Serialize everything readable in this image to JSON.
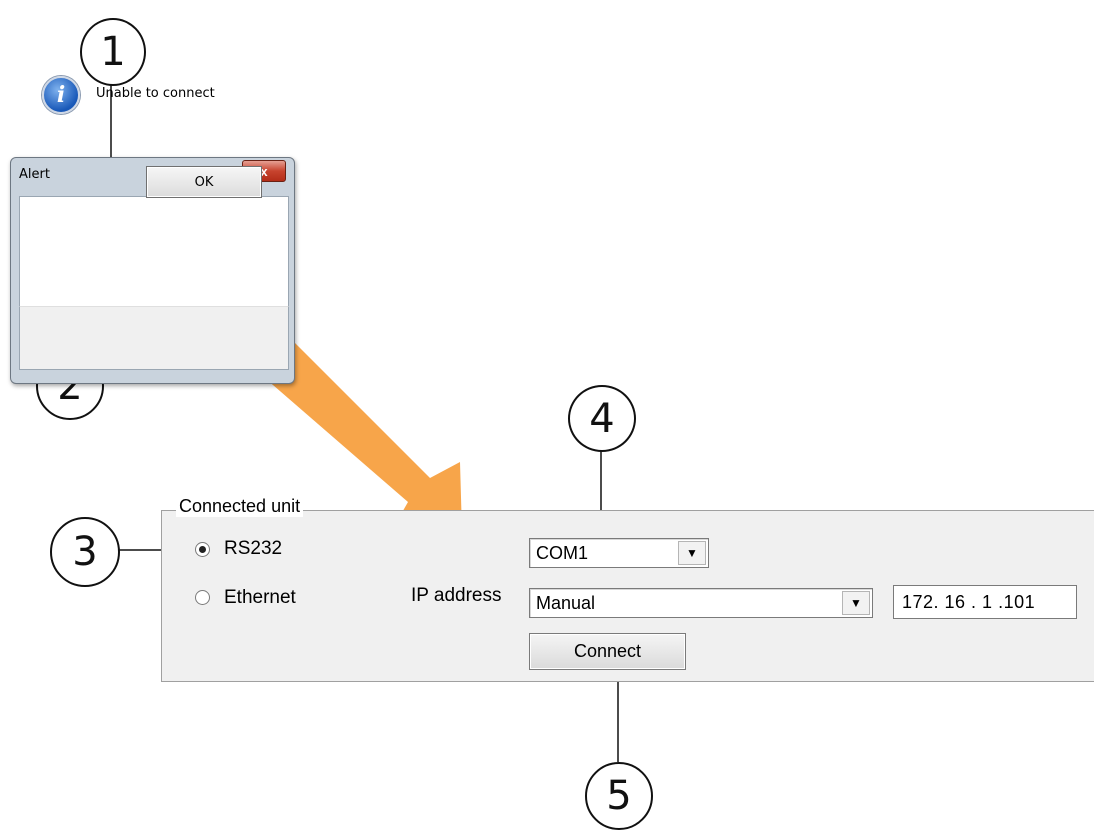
{
  "alert": {
    "title": "Alert",
    "close_label": "x",
    "icon": "info-icon",
    "message": "Unable to connect",
    "ok_label": "OK"
  },
  "panel": {
    "group_label": "Connected unit",
    "options": [
      {
        "label": "RS232",
        "selected": true
      },
      {
        "label": "Ethernet",
        "selected": false
      }
    ],
    "com_port": {
      "value": "COM1",
      "icon": "chevron-down-icon"
    },
    "ip_label": "IP address",
    "ip_mode": {
      "value": "Manual",
      "icon": "chevron-down-icon"
    },
    "ip_value": "172. 16 .  1  .101",
    "connect_label": "Connect"
  },
  "callouts": [
    "1",
    "2",
    "3",
    "4",
    "5"
  ],
  "colors": {
    "arrow": "#f7a040",
    "info_blue": "#1858b8",
    "close_red": "#c7432e"
  }
}
